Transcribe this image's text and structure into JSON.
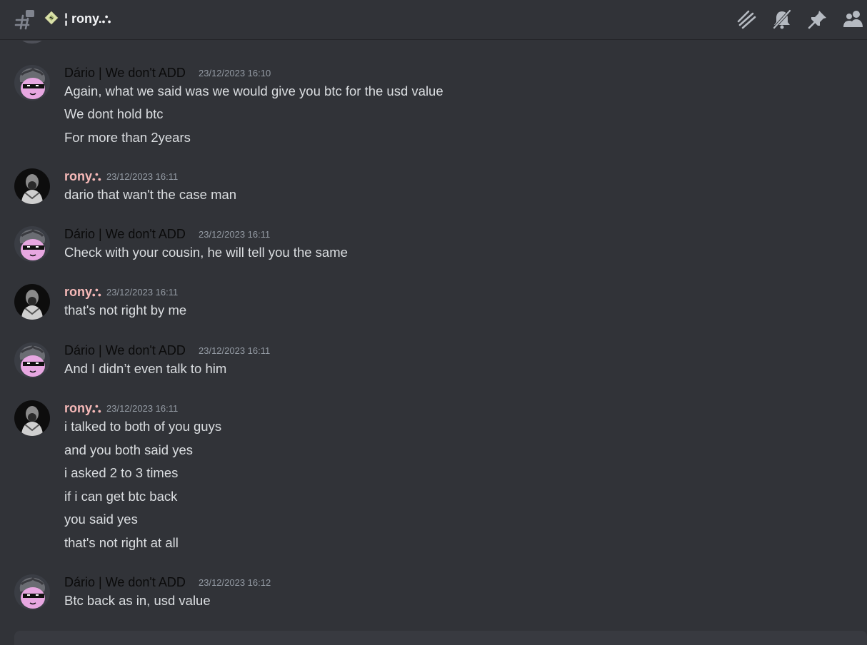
{
  "header": {
    "channel_name": "¦ rony.⛬",
    "icons": [
      "threads-icon",
      "notification-muted-icon",
      "pin-icon",
      "members-icon"
    ]
  },
  "colors": {
    "background": "#313338",
    "dario_name": "#0a0a0a",
    "rony_name": "#f6b9b8",
    "message_text": "#dbdee1",
    "timestamp": "#949ba4"
  },
  "messages": [
    {
      "author": "Dário | We don't ADD",
      "timestamp": "23/12/2023 16:10",
      "lines": [
        "Again, what we said was we would give you btc for the usd value",
        "We dont hold btc",
        "For more than 2years"
      ]
    },
    {
      "author": "rony⛬",
      "timestamp": "23/12/2023 16:11",
      "lines": [
        "dario that wan't the case man"
      ]
    },
    {
      "author": "Dário | We don't ADD",
      "timestamp": "23/12/2023 16:11",
      "lines": [
        "Check with your cousin, he will tell you the same"
      ]
    },
    {
      "author": "rony⛬",
      "timestamp": "23/12/2023 16:11",
      "lines": [
        "that's not right by me"
      ]
    },
    {
      "author": "Dário | We don't ADD",
      "timestamp": "23/12/2023 16:11",
      "lines": [
        "And I didn’t even talk to him"
      ]
    },
    {
      "author": "rony⛬",
      "timestamp": "23/12/2023 16:11",
      "lines": [
        "i talked to both of you guys",
        "and you both said yes",
        "i asked 2 to 3 times",
        "if i can get btc back",
        "you said yes",
        "that's not right at all"
      ]
    },
    {
      "author": "Dário | We don't ADD",
      "timestamp": "23/12/2023 16:12",
      "lines": [
        "Btc back as in, usd value"
      ]
    }
  ]
}
